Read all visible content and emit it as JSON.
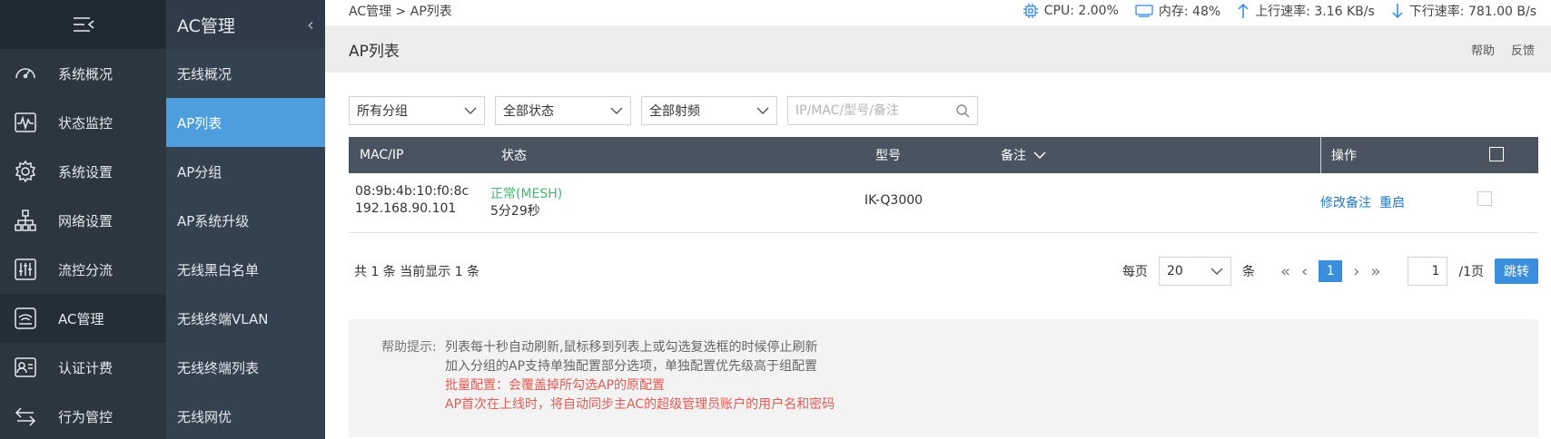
{
  "sidebar": {
    "menu_icon": "menu-collapse-icon",
    "items": [
      {
        "label": "系统概况",
        "icon": "dashboard-icon"
      },
      {
        "label": "状态监控",
        "icon": "monitor-icon"
      },
      {
        "label": "系统设置",
        "icon": "gear-icon"
      },
      {
        "label": "网络设置",
        "icon": "network-icon"
      },
      {
        "label": "流控分流",
        "icon": "sliders-icon"
      },
      {
        "label": "AC管理",
        "icon": "wifi-router-icon"
      },
      {
        "label": "认证计费",
        "icon": "id-card-icon"
      },
      {
        "label": "行为管控",
        "icon": "arrows-icon"
      }
    ]
  },
  "subnav": {
    "title": "AC管理",
    "items": [
      {
        "label": "无线概况"
      },
      {
        "label": "AP列表"
      },
      {
        "label": "AP分组"
      },
      {
        "label": "AP系统升级"
      },
      {
        "label": "无线黑白名单"
      },
      {
        "label": "无线终端VLAN"
      },
      {
        "label": "无线终端列表"
      },
      {
        "label": "无线网优"
      }
    ]
  },
  "topbar": {
    "breadcrumb": "AC管理 > AP列表",
    "cpu": "CPU: 2.00%",
    "mem": "内存: 48%",
    "up": "上行速率: 3.16 KB/s",
    "down": "下行速率: 781.00 B/s"
  },
  "title": {
    "text": "AP列表",
    "help": "帮助",
    "feedback": "反馈"
  },
  "filters": {
    "group": "所有分组",
    "status": "全部状态",
    "band": "全部射频",
    "search_placeholder": "IP/MAC/型号/备注"
  },
  "table": {
    "headers": {
      "mac_ip": "MAC/IP",
      "status": "状态",
      "model": "型号",
      "remark": "备注",
      "action": "操作"
    },
    "rows": [
      {
        "mac": "08:9b:4b:10:f0:8c",
        "ip": "192.168.90.101",
        "status": "正常(MESH)",
        "uptime": "5分29秒",
        "model": "IK-Q3000",
        "remark": "",
        "edit": "修改备注",
        "reboot": "重启"
      }
    ]
  },
  "footer": {
    "summary": "共 1 条 当前显示 1 条",
    "per_page_label": "每页",
    "per_page": "20",
    "unit": "条",
    "current_page": "1",
    "jump_value": "1",
    "total_pages": "/1页",
    "jump_button": "跳转"
  },
  "help": {
    "label": "帮助提示:",
    "lines": [
      "列表每十秒自动刷新,鼠标移到列表上或勾选复选框的时候停止刷新",
      "加入分组的AP支持单独配置部分选项，单独配置优先级高于组配置",
      "批量配置：会覆盖掉所勾选AP的原配置",
      "AP首次在上线时，将自动同步主AC的超级管理员账户的用户名和密码"
    ]
  },
  "colors": {
    "accent": "#4e9ede",
    "status_ok": "#3dbb6e",
    "warn": "#e05d55"
  }
}
